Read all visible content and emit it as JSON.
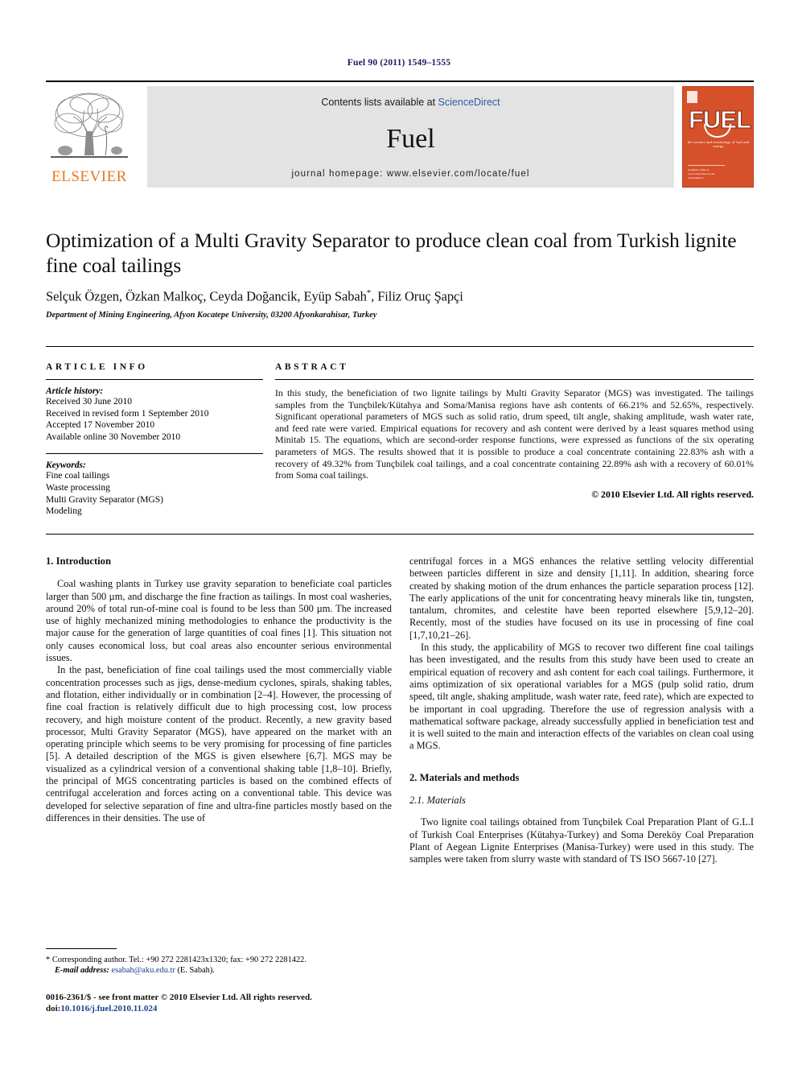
{
  "running_head": "Fuel 90 (2011) 1549–1555",
  "masthead": {
    "contents_prefix": "Contents lists available at ",
    "sciencedirect": "ScienceDirect",
    "journal_name": "Fuel",
    "homepage": "journal homepage: www.elsevier.com/locate/fuel",
    "publisher_logo_text": "ELSEVIER",
    "cover_title": "FUEL",
    "cover_tagline": "the science and technology of fuel and energy",
    "cover_footer": "Available online at www.sciencedirect.com",
    "cover_footer2": "ScienceDirect"
  },
  "article": {
    "title": "Optimization of a Multi Gravity Separator to produce clean coal from Turkish lignite fine coal tailings",
    "authors": "Selçuk Özgen, Özkan Malkoç, Ceyda Doğancik, Eyüp Sabah",
    "authors_star": "*",
    "authors_tail": ", Filiz Oruç Şapçi",
    "affiliation": "Department of Mining Engineering, Afyon Kocatepe University, 03200 Afyonkarahisar, Turkey"
  },
  "info": {
    "kicker": "ARTICLE INFO",
    "history_label": "Article history:",
    "history": [
      "Received 30 June 2010",
      "Received in revised form 1 September 2010",
      "Accepted 17 November 2010",
      "Available online 30 November 2010"
    ],
    "keywords_label": "Keywords:",
    "keywords": [
      "Fine coal tailings",
      "Waste processing",
      "Multi Gravity Separator (MGS)",
      "Modeling"
    ]
  },
  "abstract": {
    "kicker": "ABSTRACT",
    "text": "In this study, the beneficiation of two lignite tailings by Multi Gravity Separator (MGS) was investigated. The tailings samples from the Tunçbilek/Kütahya and Soma/Manisa regions have ash contents of 66.21% and 52.65%, respectively. Significant operational parameters of MGS such as solid ratio, drum speed, tilt angle, shaking amplitude, wash water rate, and feed rate were varied. Empirical equations for recovery and ash content were derived by a least squares method using Minitab 15. The equations, which are second-order response functions, were expressed as functions of the six operating parameters of MGS. The results showed that it is possible to produce a coal concentrate containing 22.83% ash with a recovery of 49.32% from Tunçbilek coal tailings, and a coal concentrate containing 22.89% ash with a recovery of 60.01% from Soma coal tailings.",
    "copyright": "© 2010 Elsevier Ltd. All rights reserved."
  },
  "body": {
    "intro_heading": "1. Introduction",
    "intro_p1": "Coal washing plants in Turkey use gravity separation to beneficiate coal particles larger than 500 µm, and discharge the fine fraction as tailings. In most coal washeries, around 20% of total run-of-mine coal is found to be less than 500 µm. The increased use of highly mechanized mining methodologies to enhance the productivity is the major cause for the generation of large quantities of coal fines [1]. This situation not only causes economical loss, but coal areas also encounter serious environmental issues.",
    "intro_p2": "In the past, beneficiation of fine coal tailings used the most commercially viable concentration processes such as jigs, dense-medium cyclones, spirals, shaking tables, and flotation, either individually or in combination [2–4]. However, the processing of fine coal fraction is relatively difficult due to high processing cost, low process recovery, and high moisture content of the product. Recently, a new gravity based processor, Multi Gravity Separator (MGS), have appeared on the market with an operating principle which seems to be very promising for processing of fine particles [5]. A detailed description of the MGS is given elsewhere [6,7]. MGS may be visualized as a cylindrical version of a conventional shaking table [1,8–10]. Briefly, the principal of MGS concentrating particles is based on the combined effects of centrifugal acceleration and forces acting on a conventional table. This device was developed for selective separation of fine and ultra-fine particles mostly based on the differences in their densities. The use of",
    "right_p1": "centrifugal forces in a MGS enhances the relative settling velocity differential between particles different in size and density [1,11]. In addition, shearing force created by shaking motion of the drum enhances the particle separation process [12]. The early applications of the unit for concentrating heavy minerals like tin, tungsten, tantalum, chromites, and celestite have been reported elsewhere [5,9,12–20]. Recently, most of the studies have focused on its use in processing of fine coal [1,7,10,21–26].",
    "right_p2": "In this study, the applicability of MGS to recover two different fine coal tailings has been investigated, and the results from this study have been used to create an empirical equation of recovery and ash content for each coal tailings. Furthermore, it aims optimization of six operational variables for a MGS (pulp solid ratio, drum speed, tilt angle, shaking amplitude, wash water rate, feed rate), which are expected to be important in coal upgrading. Therefore the use of regression analysis with a mathematical software package, already successfully applied in beneficiation test and it is well suited to the main and interaction effects of the variables on clean coal using a MGS.",
    "materials_heading": "2. Materials and methods",
    "materials_sub": "2.1. Materials",
    "materials_p1": "Two lignite coal tailings obtained from Tunçbilek Coal Preparation Plant of G.L.I of Turkish Coal Enterprises (Kütahya-Turkey) and Soma Dereköy Coal Preparation Plant of Aegean Lignite Enterprises (Manisa-Turkey) were used in this study. The samples were taken from slurry waste with standard of TS ISO 5667-10 [27]."
  },
  "footnote": {
    "marker": "*",
    "line1": "Corresponding author. Tel.: +90 272 2281423x1320; fax: +90 272 2281422.",
    "email_label": "E-mail address:",
    "email": "esabah@aku.edu.tr",
    "email_tail": "(E. Sabah)."
  },
  "imprint": {
    "line1": "0016-2361/$ - see front matter © 2010 Elsevier Ltd. All rights reserved.",
    "doi_prefix": "doi:",
    "doi": "10.1016/j.fuel.2010.11.024"
  },
  "colors": {
    "header_blue": "#1a1a5e",
    "link_blue": "#1a3f8f",
    "elsevier_orange": "#E87722",
    "cover_orange": "#D6502A",
    "band_gray": "#e3e3e3"
  }
}
